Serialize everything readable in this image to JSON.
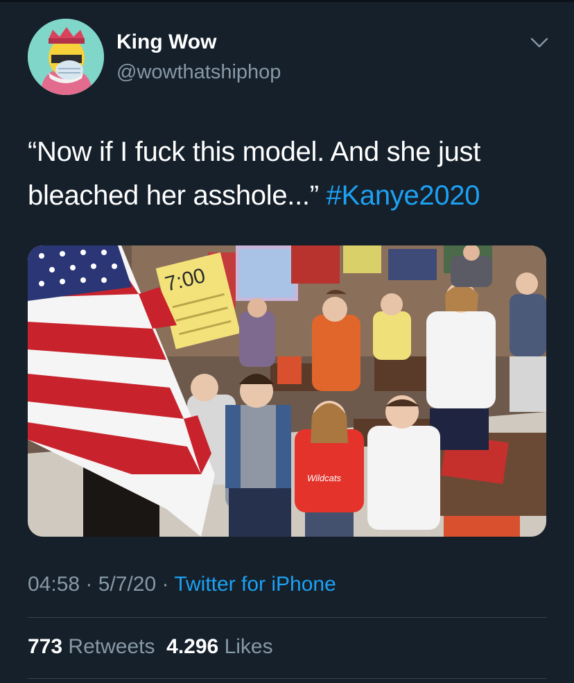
{
  "tweet": {
    "author_name": "King Wow",
    "author_handle": "@wowthatshiphop",
    "text_main": "“Now if I fuck this model. And she just bleached her asshole...”",
    "hashtag": "#Kanye2020",
    "media": {
      "clock_text": "7:00",
      "shirt_text": "Wildcats"
    },
    "time": "04:58",
    "date": "5/7/20",
    "separator": "·",
    "source": "Twitter for iPhone",
    "retweets_count": "773",
    "retweets_label": "Retweets",
    "likes_count": "4.296",
    "likes_label": "Likes"
  },
  "icons": {
    "menu": "chevron-down-icon",
    "avatar": "avatar-image"
  },
  "colors": {
    "background": "#15202b",
    "link": "#1da1f2",
    "secondary_text": "#8899a6",
    "divider": "#38444d"
  }
}
